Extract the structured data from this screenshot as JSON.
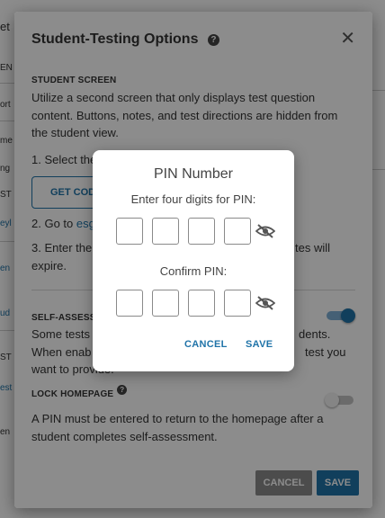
{
  "background": {
    "fragments": [
      "et",
      "EN",
      "ort",
      "me",
      "ng",
      "ST",
      "eyl",
      "en",
      "ud",
      "nt",
      "ST",
      "est",
      "en"
    ]
  },
  "options_dialog": {
    "title": "Student-Testing Options",
    "close_glyph": "✕",
    "student_screen": {
      "heading": "STUDENT SCREEN",
      "description": "Utilize a second screen that only displays test question content. Buttons, notes, and test directions are hidden from the student view.",
      "step1": "1. Select the",
      "get_code_label": "GET CODE",
      "step2_prefix": "2. Go to ",
      "step2_link": "esg",
      "step3_line1_left": "3. Enter the",
      "step3_line1_right": "tes will",
      "step3_line2": "expire."
    },
    "self_assessment": {
      "heading": "SELF-ASSESS",
      "line1_left": "Some tests",
      "line1_right": "dents.",
      "line2_left": "When enab",
      "line2_right": "test you",
      "line3": "want to provide.",
      "toggle_on": true
    },
    "lock_homepage": {
      "heading": "LOCK HOMEPAGE",
      "description": "A PIN  must be entered to return to the homepage after a student completes self-assessment.",
      "toggle_on": false
    },
    "cancel_label": "CANCEL",
    "save_label": "SAVE"
  },
  "pin_dialog": {
    "title": "PIN Number",
    "enter_label": "Enter four digits for PIN:",
    "confirm_label": "Confirm PIN:",
    "pin_digits": [
      "",
      "",
      "",
      ""
    ],
    "confirm_digits": [
      "",
      "",
      "",
      ""
    ],
    "cancel_label": "CANCEL",
    "save_label": "SAVE"
  },
  "colors": {
    "accent": "#1f73a8",
    "overlay": "rgba(0,0,0,0.45)",
    "toggle_track_on": "#7fb0d6"
  }
}
